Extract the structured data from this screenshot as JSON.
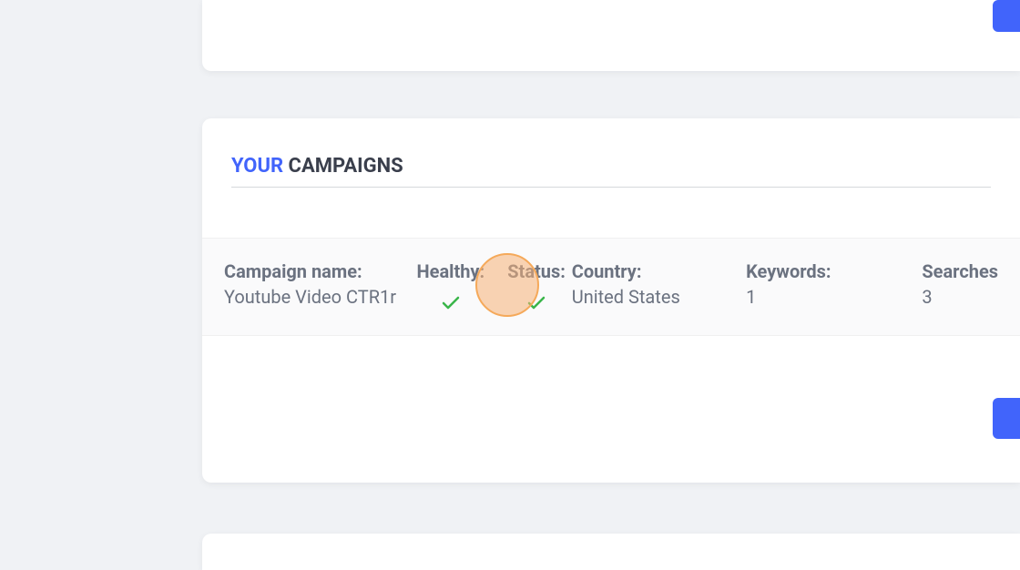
{
  "section": {
    "title_highlight": "YOUR",
    "title_rest": " CAMPAIGNS"
  },
  "table": {
    "headers": {
      "campaign_name": "Campaign name:",
      "healthy": "Healthy:",
      "status": "Status:",
      "country": "Country:",
      "keywords": "Keywords:",
      "searches": "Searches"
    },
    "row": {
      "campaign_name": "Youtube Video CTR1r",
      "country": "United States",
      "keywords": "1",
      "searches": "3"
    }
  }
}
